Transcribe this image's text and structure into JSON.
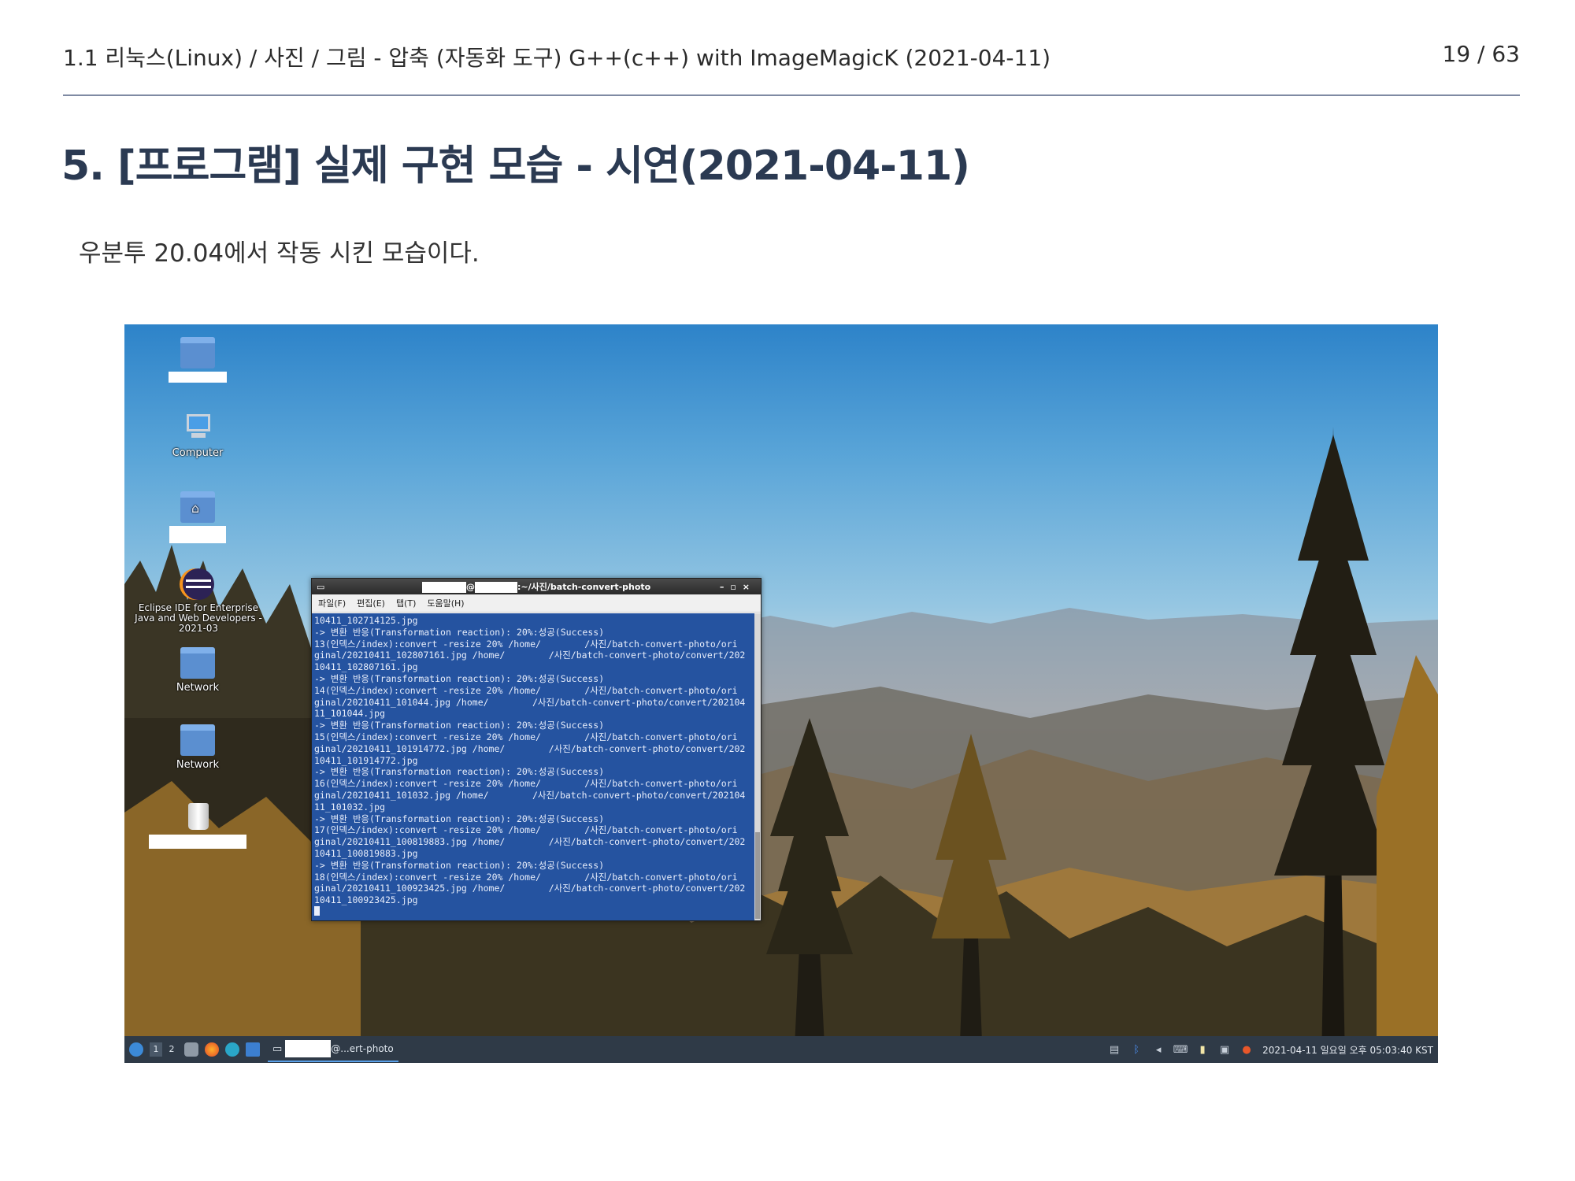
{
  "header": {
    "breadcrumb": "1.1 리눅스(Linux) / 사진 / 그림 - 압축 (자동화 도구) G++(c++) with ImageMagicK (2021-04-11)",
    "page_number": "19 / 63"
  },
  "title": "5. [프로그램] 실제 구현 모습 - 시연(2021-04-11)",
  "body_text": "우분투 20.04에서 작동 시킨 모습이다.",
  "desktop": {
    "icons": [
      {
        "name": "home-folder-icon",
        "label": ""
      },
      {
        "name": "computer-icon",
        "label": "Computer"
      },
      {
        "name": "user-home-icon",
        "label": ""
      },
      {
        "name": "eclipse-icon",
        "label": "Eclipse IDE for Enterprise Java and Web Developers - 2021-03"
      },
      {
        "name": "network-folder-icon",
        "label": "Network"
      },
      {
        "name": "network-folder-icon-2",
        "label": "Network"
      },
      {
        "name": "trash-icon",
        "label": ""
      }
    ]
  },
  "terminal": {
    "title_suffix": ":~/사진/batch-convert-photo",
    "title_at": "@",
    "menu": [
      "파일(F)",
      "편집(E)",
      "탭(T)",
      "도움말(H)"
    ],
    "lines": [
      "10411_102714125.jpg",
      "-> 변환 반응(Transformation reaction): 20%:성공(Success)",
      "13(인덱스/index):convert -resize 20% /home/        /사진/batch-convert-photo/ori",
      "ginal/20210411_102807161.jpg /home/        /사진/batch-convert-photo/convert/202",
      "10411_102807161.jpg",
      "-> 변환 반응(Transformation reaction): 20%:성공(Success)",
      "14(인덱스/index):convert -resize 20% /home/        /사진/batch-convert-photo/ori",
      "ginal/20210411_101044.jpg /home/        /사진/batch-convert-photo/convert/202104",
      "11_101044.jpg",
      "-> 변환 반응(Transformation reaction): 20%:성공(Success)",
      "15(인덱스/index):convert -resize 20% /home/        /사진/batch-convert-photo/ori",
      "ginal/20210411_101914772.jpg /home/        /사진/batch-convert-photo/convert/202",
      "10411_101914772.jpg",
      "-> 변환 반응(Transformation reaction): 20%:성공(Success)",
      "16(인덱스/index):convert -resize 20% /home/        /사진/batch-convert-photo/ori",
      "ginal/20210411_101032.jpg /home/        /사진/batch-convert-photo/convert/202104",
      "11_101032.jpg",
      "-> 변환 반응(Transformation reaction): 20%:성공(Success)",
      "17(인덱스/index):convert -resize 20% /home/        /사진/batch-convert-photo/ori",
      "ginal/20210411_100819883.jpg /home/        /사진/batch-convert-photo/convert/202",
      "10411_100819883.jpg",
      "-> 변환 반응(Transformation reaction): 20%:성공(Success)",
      "18(인덱스/index):convert -resize 20% /home/        /사진/batch-convert-photo/ori",
      "ginal/20210411_100923425.jpg /home/        /사진/batch-convert-photo/convert/202",
      "10411_100923425.jpg"
    ]
  },
  "taskbar": {
    "workspaces": [
      "1",
      "2"
    ],
    "task_label": "@...ert-photo",
    "clock": "2021-04-11 일요일 오후 05:03:40 KST"
  },
  "colors": {
    "title": "#2b3a52",
    "terminal_bg": "#2553a0",
    "taskbar_bg": "#2f3a47"
  }
}
